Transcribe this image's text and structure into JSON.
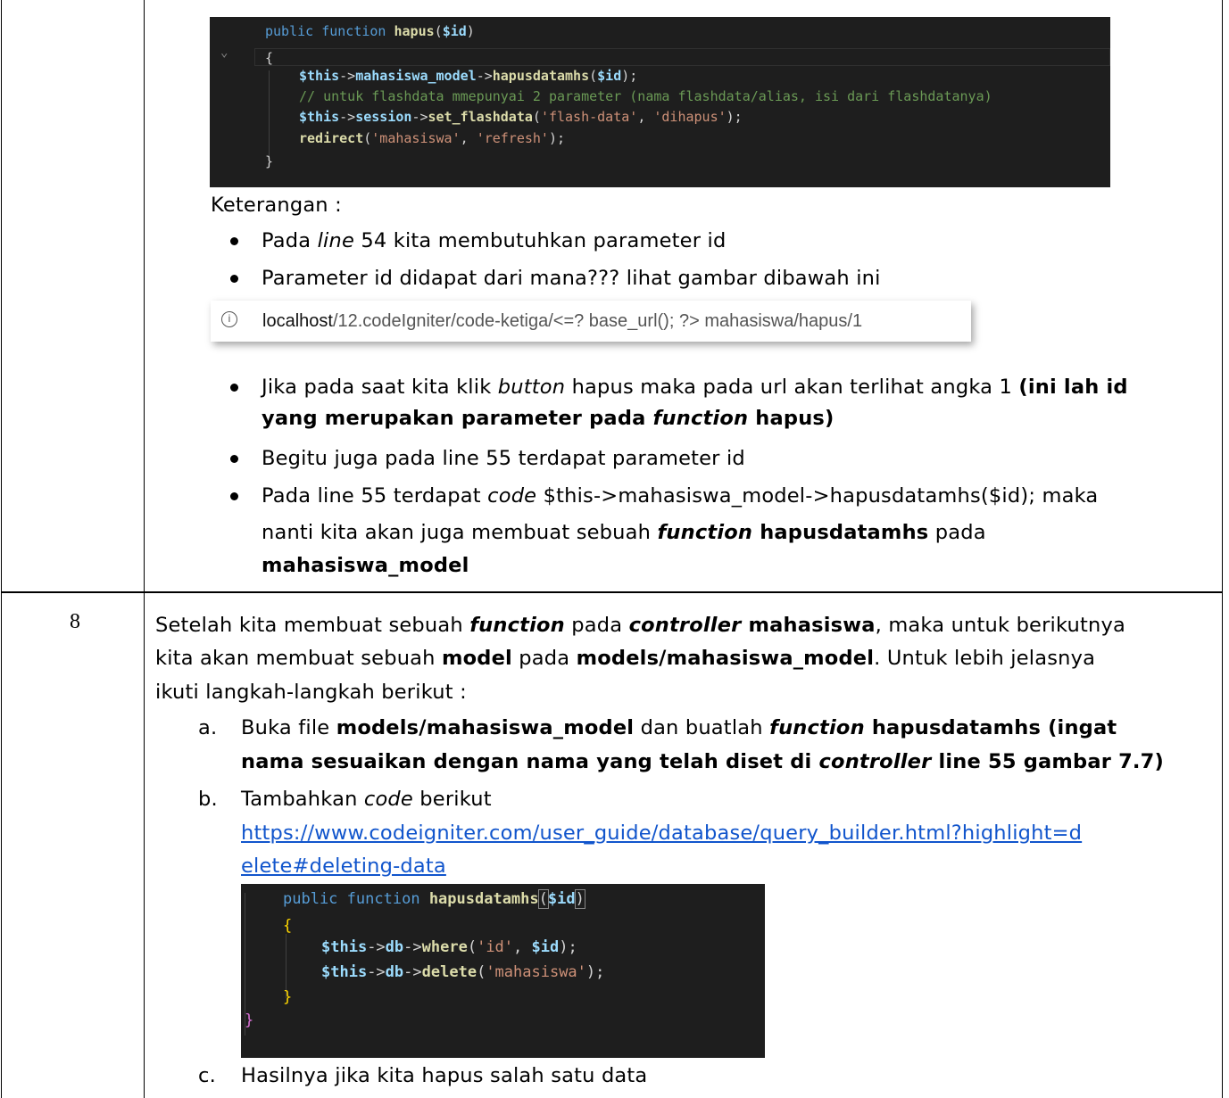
{
  "code1": {
    "line1": {
      "kw": "public",
      "kw2": "function",
      "fn": "hapus",
      "open": "(",
      "var": "$id",
      "close": ")"
    },
    "brace_open": "{",
    "line2": {
      "var": "$this",
      "arrow": "->",
      "prop": "mahasiswa_model",
      "arrow2": "->",
      "fn": "hapusdatamhs",
      "open": "(",
      "arg": "$id",
      "close": ");"
    },
    "comment": "// untuk flashdata mmepunyai 2 parameter (nama flashdata/alias, isi dari flashdatanya)",
    "line4": {
      "var": "$this",
      "arrow": "->",
      "prop": "session",
      "arrow2": "->",
      "fn": "set_flashdata",
      "open": "(",
      "s1": "'flash-data'",
      "comma": ", ",
      "s2": "'dihapus'",
      "close": ");"
    },
    "line5": {
      "fn": "redirect",
      "open": "(",
      "s1": "'mahasiswa'",
      "comma": ", ",
      "s2": "'refresh'",
      "close": ");"
    },
    "brace_close": "}"
  },
  "keterangan": "Keterangan :",
  "bullets": {
    "b1": {
      "a": "Pada ",
      "b": "line",
      "c": " 54 kita membutuhkan parameter id"
    },
    "b2": "Parameter id didapat dari mana??? lihat gambar dibawah ini",
    "b3": {
      "a": "Jika pada saat kita klik ",
      "b": "button",
      "c": " hapus maka pada url akan terlihat angka 1 ",
      "d": "(ini lah id",
      "e": "yang merupakan parameter pada ",
      "f": "function",
      "g": " hapus)"
    },
    "b4": "Begitu juga pada line 55 terdapat parameter id",
    "b5": {
      "a": "Pada line 55 terdapat ",
      "b": "code",
      "c": " $this->mahasiswa_model->hapusdatamhs($id); maka",
      "d": "nanti kita akan juga membuat sebuah ",
      "e": "function",
      "f": " hapusdatamhs",
      "g": " pada",
      "h": "mahasiswa_model"
    }
  },
  "urlbar": {
    "icon": "info-circle-icon",
    "host": "localhost",
    "path": "/12.codeIgniter/code-ketiga/<=? base_url(); ?> mahasiswa/hapus/1"
  },
  "row8": {
    "number": "8",
    "p1": {
      "a": "Setelah kita membuat sebuah ",
      "b": "function",
      "c": " pada ",
      "d": "controller",
      "e": " mahasiswa",
      "f": ", maka untuk berikutnya"
    },
    "p2": {
      "a": "kita akan membuat sebuah ",
      "b": "model",
      "c": " pada ",
      "d": "models/mahasiswa_model",
      "e": ". Untuk lebih jelasnya"
    },
    "p3": "ikuti langkah-langkah berikut :",
    "a": {
      "marker": "a.",
      "t1": "Buka file ",
      "t2": "models/mahasiswa_model",
      "t3": " dan buatlah ",
      "t4": "function",
      "t5": " hapusdatamhs (ingat",
      "t6": "nama sesuaikan dengan nama yang telah diset di ",
      "t7": "controller",
      "t8": " line 55 gambar 7.7)"
    },
    "b": {
      "marker": "b.",
      "t1": "Tambahkan ",
      "t2": "code",
      "t3": " berikut",
      "link1": "https://www.codeigniter.com/user_guide/database/query_builder.html?highlight=d",
      "link2": "elete#deleting-data"
    },
    "c": {
      "marker": "c.",
      "t1": "Hasilnya jika kita hapus salah satu data"
    }
  },
  "code2": {
    "line1": {
      "kw": "public",
      "kw2": "function",
      "fn": "hapusdatamhs",
      "open": "(",
      "var": "$id",
      "close": ")"
    },
    "brace_open": "{",
    "line3": {
      "var": "$this",
      "arrow": "->",
      "prop": "db",
      "arrow2": "->",
      "fn": "where",
      "open": "(",
      "s1": "'id'",
      "comma": ", ",
      "arg": "$id",
      "close": ");"
    },
    "line4": {
      "var": "$this",
      "arrow": "->",
      "prop": "db",
      "arrow2": "->",
      "fn": "delete",
      "open": "(",
      "s1": "'mahasiswa'",
      "close": ");"
    },
    "brace_close": "}",
    "outer_close": "}"
  }
}
